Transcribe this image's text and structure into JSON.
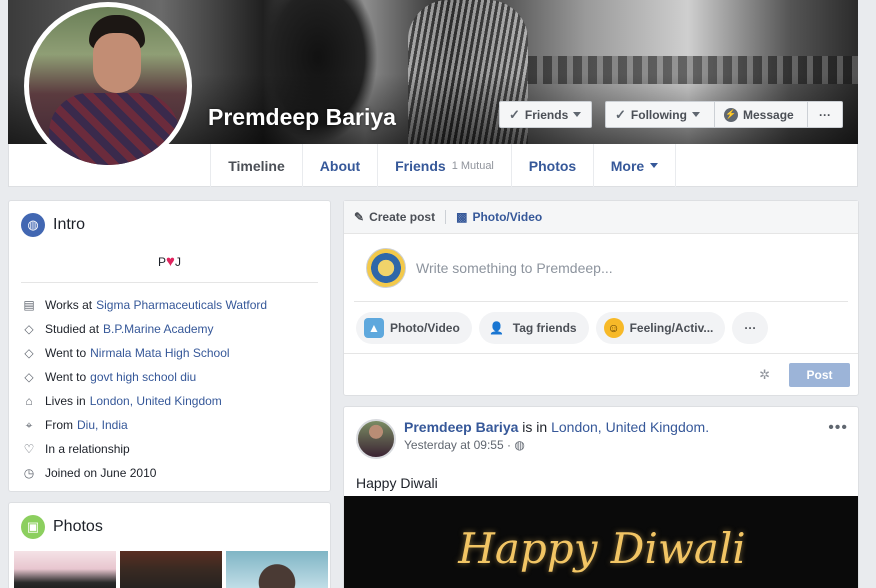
{
  "profile": {
    "name": "Premdeep Bariya",
    "buttons": {
      "friends": "Friends",
      "following": "Following",
      "message": "Message",
      "more": "···"
    }
  },
  "nav": {
    "tabs": [
      {
        "label": "Timeline"
      },
      {
        "label": "About"
      },
      {
        "label": "Friends",
        "sub": "1 Mutual"
      },
      {
        "label": "Photos"
      },
      {
        "label": "More"
      }
    ]
  },
  "intro": {
    "title": "Intro",
    "bio_left": "P",
    "bio_right": "J",
    "items": [
      {
        "prefix": "Works at",
        "link": "Sigma Pharmaceuticals Watford",
        "icon": "briefcase-icon"
      },
      {
        "prefix": "Studied at",
        "link": "B.P.Marine Academy",
        "icon": "graduation-cap-icon"
      },
      {
        "prefix": "Went to",
        "link": "Nirmala Mata High School",
        "icon": "graduation-cap-icon"
      },
      {
        "prefix": "Went to",
        "link": "govt high school diu",
        "icon": "graduation-cap-icon"
      },
      {
        "prefix": "Lives in",
        "link": "London, United Kingdom",
        "icon": "home-icon"
      },
      {
        "prefix": "From",
        "link": "Diu, India",
        "icon": "location-pin-icon"
      },
      {
        "prefix": "In a relationship",
        "link": "",
        "icon": "heart-outline-icon"
      },
      {
        "prefix": "Joined on June 2010",
        "link": "",
        "icon": "clock-icon"
      }
    ]
  },
  "photos": {
    "title": "Photos"
  },
  "composer": {
    "create_post": "Create post",
    "photo_video_tab": "Photo/Video",
    "placeholder": "Write something to Premdeep...",
    "pills": [
      "Photo/Video",
      "Tag friends",
      "Feeling/Activ...",
      "···"
    ],
    "post_button": "Post"
  },
  "feed_post": {
    "author": "Premdeep Bariya",
    "is_in": "is in",
    "location": "London, United Kingdom.",
    "time": "Yesterday at 09:55 ·",
    "text": "Happy Diwali",
    "image_text": "Happy Diwali"
  }
}
